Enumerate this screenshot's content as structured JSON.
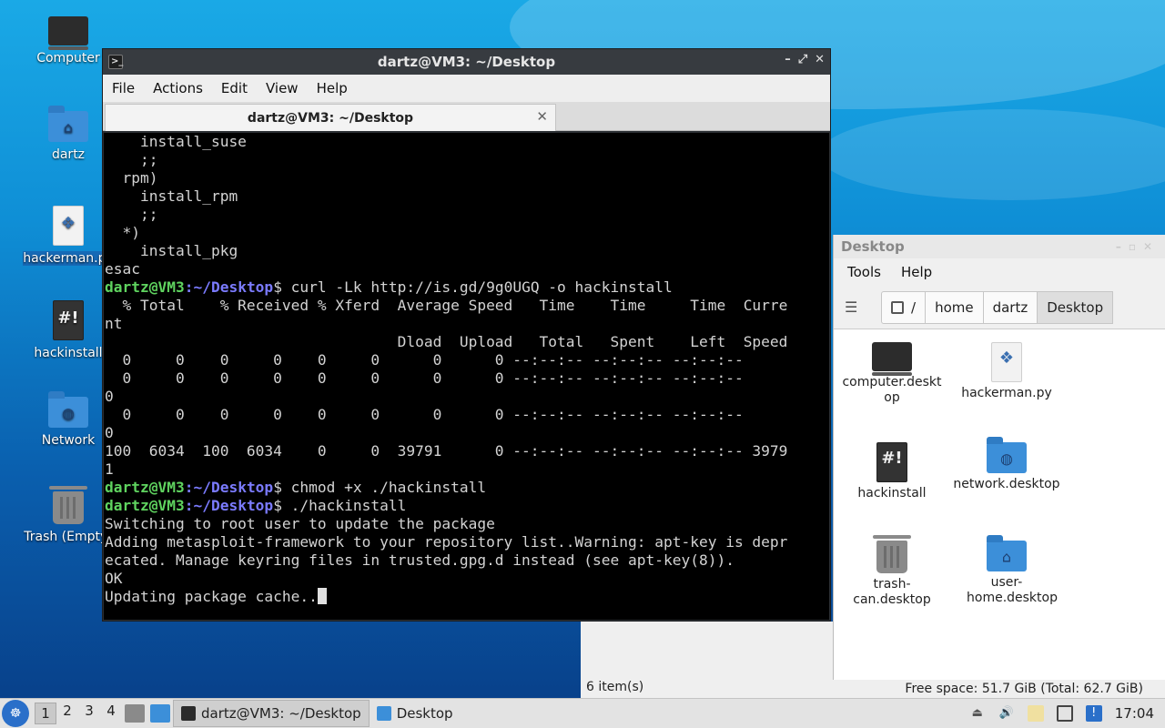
{
  "desktop": {
    "icons": [
      {
        "label": "Computer",
        "icon": "monitor-icon"
      },
      {
        "label": "dartz",
        "icon": "home-folder-icon"
      },
      {
        "label": "hackerman.py",
        "icon": "python-file-icon"
      },
      {
        "label": "hackinstall",
        "icon": "script-file-icon"
      },
      {
        "label": "Network",
        "icon": "network-folder-icon"
      },
      {
        "label": "Trash (Empty)",
        "icon": "trash-icon"
      }
    ]
  },
  "terminal": {
    "title": "dartz@VM3: ~/Desktop",
    "menu": [
      "File",
      "Actions",
      "Edit",
      "View",
      "Help"
    ],
    "tab_label": "dartz@VM3: ~/Desktop",
    "prompt_user": "dartz@VM3",
    "prompt_path": ":~/Desktop",
    "lines": {
      "l1": "    install_suse",
      "l2": "    ;;",
      "l3": "  rpm)",
      "l4": "    install_rpm",
      "l5": "    ;;",
      "l6": "  *)",
      "l7": "    install_pkg",
      "l8": "esac",
      "cmd1": "$ curl -Lk http://is.gd/9g0UGQ -o hackinstall",
      "l10": "  % Total    % Received % Xferd  Average Speed   Time    Time     Time  Curre",
      "l11": "nt",
      "l12": "                                 Dload  Upload   Total   Spent    Left  Speed",
      "l13": "  0     0    0     0    0     0      0      0 --:--:-- --:--:-- --:--:--",
      "l14": "  0     0    0     0    0     0      0      0 --:--:-- --:--:-- --:--:--",
      "l15": "0",
      "l16": "  0     0    0     0    0     0      0      0 --:--:-- --:--:-- --:--:--",
      "l17": "0",
      "l18": "100  6034  100  6034    0     0  39791      0 --:--:-- --:--:-- --:--:-- 3979",
      "l19": "1",
      "cmd2": "$ chmod +x ./hackinstall",
      "cmd3": "$ ./hackinstall",
      "o1": "Switching to root user to update the package",
      "o2": "Adding metasploit-framework to your repository list..Warning: apt-key is depr",
      "o3": "ecated. Manage keyring files in trusted.gpg.d instead (see apt-key(8)).",
      "o4": "OK",
      "o5": "Updating package cache.."
    }
  },
  "file_manager": {
    "title": "Desktop",
    "menu": [
      "Tools",
      "Help"
    ],
    "path": [
      "/",
      "home",
      "dartz",
      "Desktop"
    ],
    "items": [
      {
        "label": "computer.desktop",
        "icon": "monitor-icon"
      },
      {
        "label": "hackerman.py",
        "icon": "python-file-icon"
      },
      {
        "label": "hackinstall",
        "icon": "script-file-icon"
      },
      {
        "label": "network.desktop",
        "icon": "network-folder-icon"
      },
      {
        "label": "trash-can.desktop",
        "icon": "trash-icon"
      },
      {
        "label": "user-home.desktop",
        "icon": "home-folder-icon"
      }
    ],
    "item_count": "6 item(s)",
    "free_space": "Free space: 51.7 GiB (Total: 62.7 GiB)"
  },
  "taskbar": {
    "workspaces": [
      "1",
      "2",
      "3",
      "4"
    ],
    "tasks": [
      {
        "label": "dartz@VM3: ~/Desktop",
        "icon": "terminal-icon"
      },
      {
        "label": "Desktop",
        "icon": "folder-icon"
      }
    ],
    "clock": "17:04"
  }
}
